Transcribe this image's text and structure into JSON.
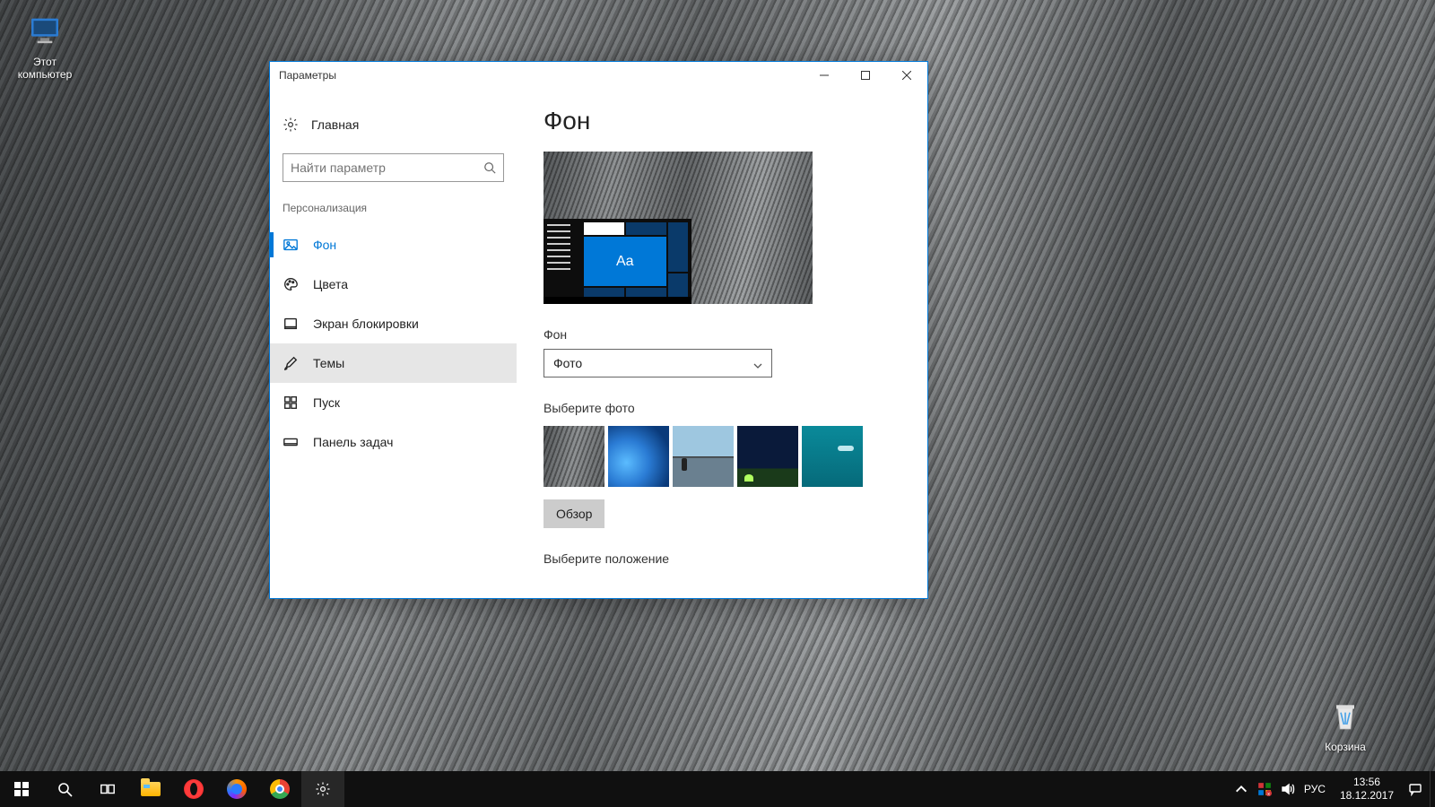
{
  "desktop": {
    "icons": {
      "this_pc": "Этот компьютер",
      "recycle_bin": "Корзина"
    }
  },
  "window": {
    "title": "Параметры",
    "home": "Главная",
    "search_placeholder": "Найти параметр",
    "category": "Персонализация",
    "nav": {
      "background": "Фон",
      "colors": "Цвета",
      "lockscreen": "Экран блокировки",
      "themes": "Темы",
      "start": "Пуск",
      "taskbar": "Панель задач"
    },
    "content": {
      "heading": "Фон",
      "preview_tile_text": "Aa",
      "bg_label": "Фон",
      "bg_dropdown_value": "Фото",
      "choose_photo_label": "Выберите фото",
      "browse": "Обзор",
      "position_label": "Выберите положение"
    }
  },
  "taskbar": {
    "lang": "РУС",
    "time": "13:56",
    "date": "18.12.2017"
  }
}
